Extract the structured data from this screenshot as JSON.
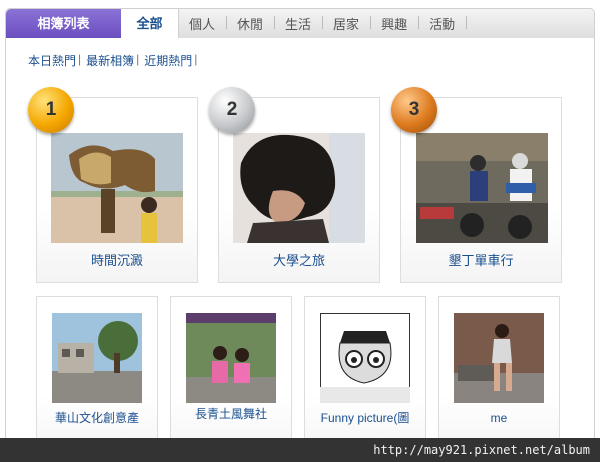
{
  "tabbar": {
    "title": "相簿列表",
    "active_tab": "全部",
    "tabs": [
      "個人",
      "休閒",
      "生活",
      "居家",
      "興趣",
      "活動"
    ]
  },
  "subnav": {
    "items": [
      "本日熱門",
      "最新相簿",
      "近期熱門"
    ]
  },
  "top_albums": [
    {
      "rank": "1",
      "medal": "gold",
      "caption": "時間沉澱"
    },
    {
      "rank": "2",
      "medal": "silver",
      "caption": "大學之旅"
    },
    {
      "rank": "3",
      "medal": "bronze",
      "caption": "墾丁單車行"
    }
  ],
  "albums": [
    {
      "caption": "華山文化創意產"
    },
    {
      "caption": "長青土風舞社"
    },
    {
      "caption": "Funny picture(圖"
    },
    {
      "caption": "me"
    }
  ],
  "status": {
    "url": "http://may921.pixnet.net/album"
  },
  "colors": {
    "accent": "#6b4fc0",
    "link": "#1a4f8f",
    "statusbar": "#333333"
  }
}
